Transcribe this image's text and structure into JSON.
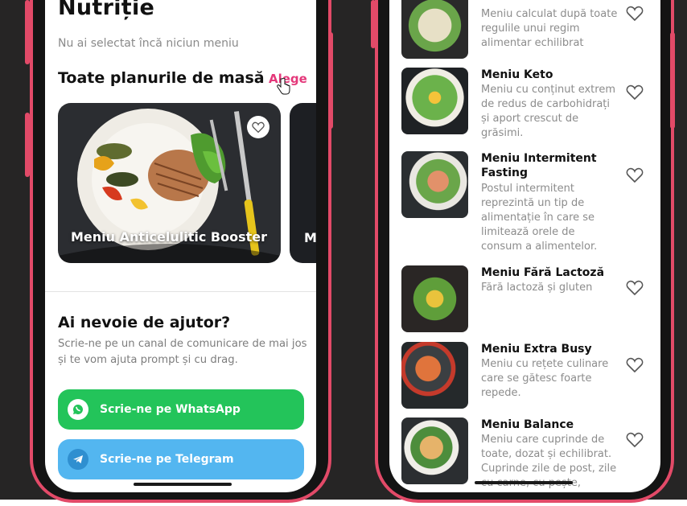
{
  "colors": {
    "frame": "#e24a68",
    "accent": "#e4387a",
    "whatsapp": "#23c45a",
    "telegram": "#53b6f0"
  },
  "left_screen": {
    "title_partial": "Nutriție",
    "no_menu_text": "Nu ai selectat încă niciun meniu",
    "plans_title": "Toate planurile de masă",
    "choose_link": "Alege",
    "cards": [
      {
        "label": "Meniu Anticelulitic Booster",
        "icon": "heart-outline-icon"
      },
      {
        "label": "M"
      }
    ],
    "help": {
      "title": "Ai nevoie de ajutor?",
      "text": "Scrie-ne pe un canal de comunicare de mai jos și te vom ajuta prompt și cu drag."
    },
    "buttons": [
      {
        "label": "Scrie-ne pe WhatsApp",
        "icon": "whatsapp-icon"
      },
      {
        "label": "Scrie-ne pe Telegram",
        "icon": "telegram-icon"
      }
    ]
  },
  "right_screen": {
    "menus": [
      {
        "title": "",
        "desc": "Meniu calculat după toate regulile unui regim alimentar echilibrat"
      },
      {
        "title": "Meniu Keto",
        "desc": "Meniu cu conținut extrem de redus de carbohidrați și aport crescut de grăsimi."
      },
      {
        "title": "Meniu Intermitent Fasting",
        "desc": "Postul intermitent reprezintă un tip de alimentație în care se limitează orele de consum a alimentelor."
      },
      {
        "title": "Meniu Fără Lactoză",
        "desc": "Fără lactoză și gluten"
      },
      {
        "title": "Meniu Extra Busy",
        "desc": "Meniu cu rețete culinare care se gătesc foarte repede."
      },
      {
        "title": "Meniu Balance",
        "desc": "Meniu care cuprinde de toate, dozat și echilibrat. Cuprinde zile de post, zile cu carne, cu pește,"
      }
    ]
  }
}
